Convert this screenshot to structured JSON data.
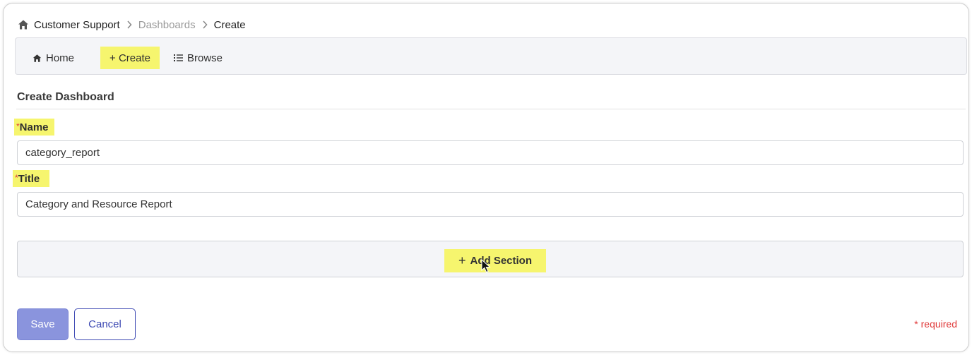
{
  "breadcrumb": {
    "root": "Customer Support",
    "middle": "Dashboards",
    "current": "Create",
    "home_icon": "home-icon",
    "separator_icon": "chevron-right-icon"
  },
  "nav": {
    "home_label": "Home",
    "create_label": "+ Create",
    "browse_label": "Browse",
    "highlight_color": "#f6f56e"
  },
  "form": {
    "heading": "Create Dashboard",
    "name": {
      "required_mark": "*",
      "label": "Name",
      "value": "category_report"
    },
    "title": {
      "required_mark": "*",
      "label": "Title",
      "value": "Category and Resource Report"
    },
    "add_section_label": "Add Section",
    "add_section_plus": "+",
    "save_label": "Save",
    "cancel_label": "Cancel",
    "required_note": "* required"
  },
  "colors": {
    "primary": "#8a94dd",
    "accent_border": "#3d49b3",
    "required": "#e03a3a"
  }
}
